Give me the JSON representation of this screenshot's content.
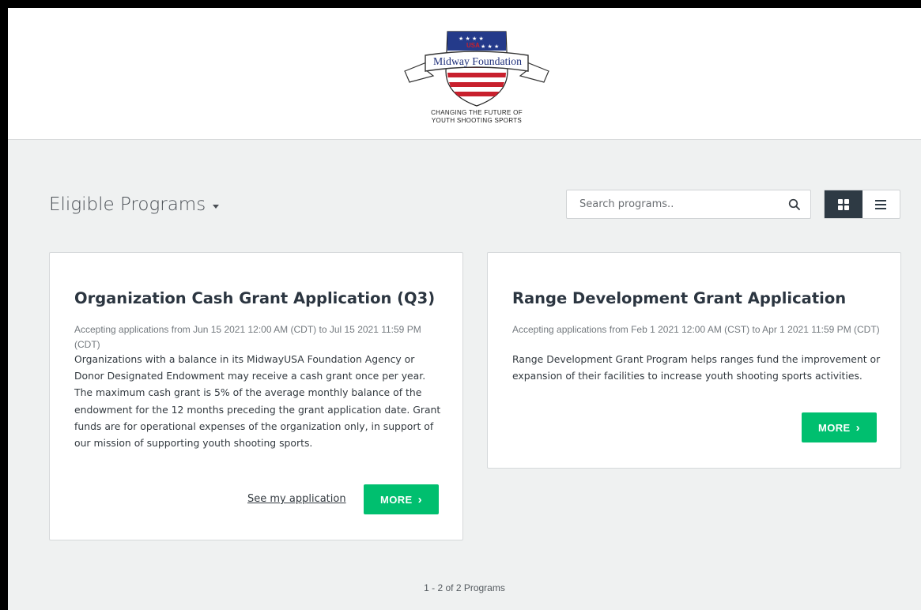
{
  "header": {
    "logo_usa": "USA",
    "logo_name": "Midway Foundation",
    "tagline_line1": "CHANGING THE FUTURE OF",
    "tagline_line2": "YOUTH SHOOTING SPORTS"
  },
  "toolbar": {
    "title": "Eligible Programs",
    "search_placeholder": "Search programs..",
    "search_value": "",
    "active_view": "grid"
  },
  "programs": [
    {
      "title": "Organization Cash Grant Application (Q3)",
      "dates": "Accepting applications from Jun 15 2021 12:00 AM (CDT) to Jul 15 2021 11:59 PM (CDT)",
      "description": "Organizations with a balance in its MidwayUSA Foundation Agency or Donor Designated Endowment may receive a cash grant once per year. The maximum cash grant is 5% of the average monthly balance of the endowment for the 12 months preceding the grant application date. Grant funds are for operational expenses of the organization only, in support of our mission of supporting youth shooting sports.",
      "secondary_link": "See my application",
      "button_label": "MORE"
    },
    {
      "title": "Range Development Grant Application",
      "dates": "Accepting applications from Feb 1 2021 12:00 AM (CST) to Apr 1 2021 11:59 PM (CDT)",
      "description": "Range Development Grant Program helps ranges fund the improvement or expansion of their facilities to increase youth shooting sports activities.",
      "button_label": "MORE"
    }
  ],
  "footer": {
    "count_text": "1 - 2 of 2 Programs"
  },
  "colors": {
    "accent_green": "#00bf6f",
    "toggle_active": "#2e3a44",
    "page_bg": "#eff1f1"
  }
}
